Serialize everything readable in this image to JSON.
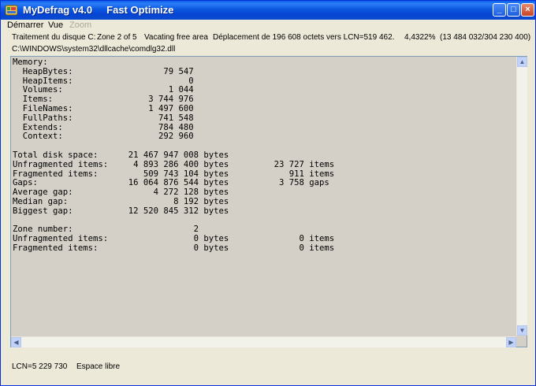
{
  "window": {
    "app_name": "MyDefrag v4.0",
    "mode": "Fast Optimize",
    "minimize_glyph": "_",
    "maximize_glyph": "□",
    "close_glyph": "×"
  },
  "menu": {
    "items": [
      {
        "label": "Démarrer",
        "enabled": true
      },
      {
        "label": "Vue",
        "enabled": true
      },
      {
        "label": "Zoom",
        "enabled": false
      }
    ]
  },
  "status": {
    "disk": "Traitement du disque C:",
    "zone": "Zone 2 of 5",
    "phase": "Vacating free area",
    "action": "Déplacement de 196 608 octets vers LCN=519 462.",
    "progress": "4,4322%  (13 484 032/304 230 400)",
    "progress_percent": 4.4322
  },
  "current_file": "C:\\WINDOWS\\system32\\dllcache\\comdlg32.dll",
  "console_lines": [
    "Memory:",
    "  HeapBytes:                  79 547",
    "  HeapItems:                       0",
    "  Volumes:                     1 044",
    "  Items:                   3 744 976",
    "  FileNames:               1 497 600",
    "  FullPaths:                 741 548",
    "  Extends:                   784 480",
    "  Context:                   292 960",
    "",
    "Total disk space:      21 467 947 008 bytes",
    "Unfragmented items:     4 893 286 400 bytes         23 727 items",
    "Fragmented items:         509 743 104 bytes            911 items",
    "Gaps:                  16 064 876 544 bytes          3 758 gaps",
    "Average gap:                4 272 128 bytes",
    "Median gap:                     8 192 bytes",
    "Biggest gap:           12 520 845 312 bytes",
    "",
    "Zone number:                        2",
    "Unfragmented items:                 0 bytes              0 items",
    "Fragmented items:                   0 bytes              0 items"
  ],
  "bottom_status": {
    "lcn": "LCN=5 229 730",
    "area": "Espace libre"
  },
  "scroll": {
    "up_glyph": "▲",
    "down_glyph": "▼",
    "left_glyph": "◀",
    "right_glyph": "▶"
  }
}
